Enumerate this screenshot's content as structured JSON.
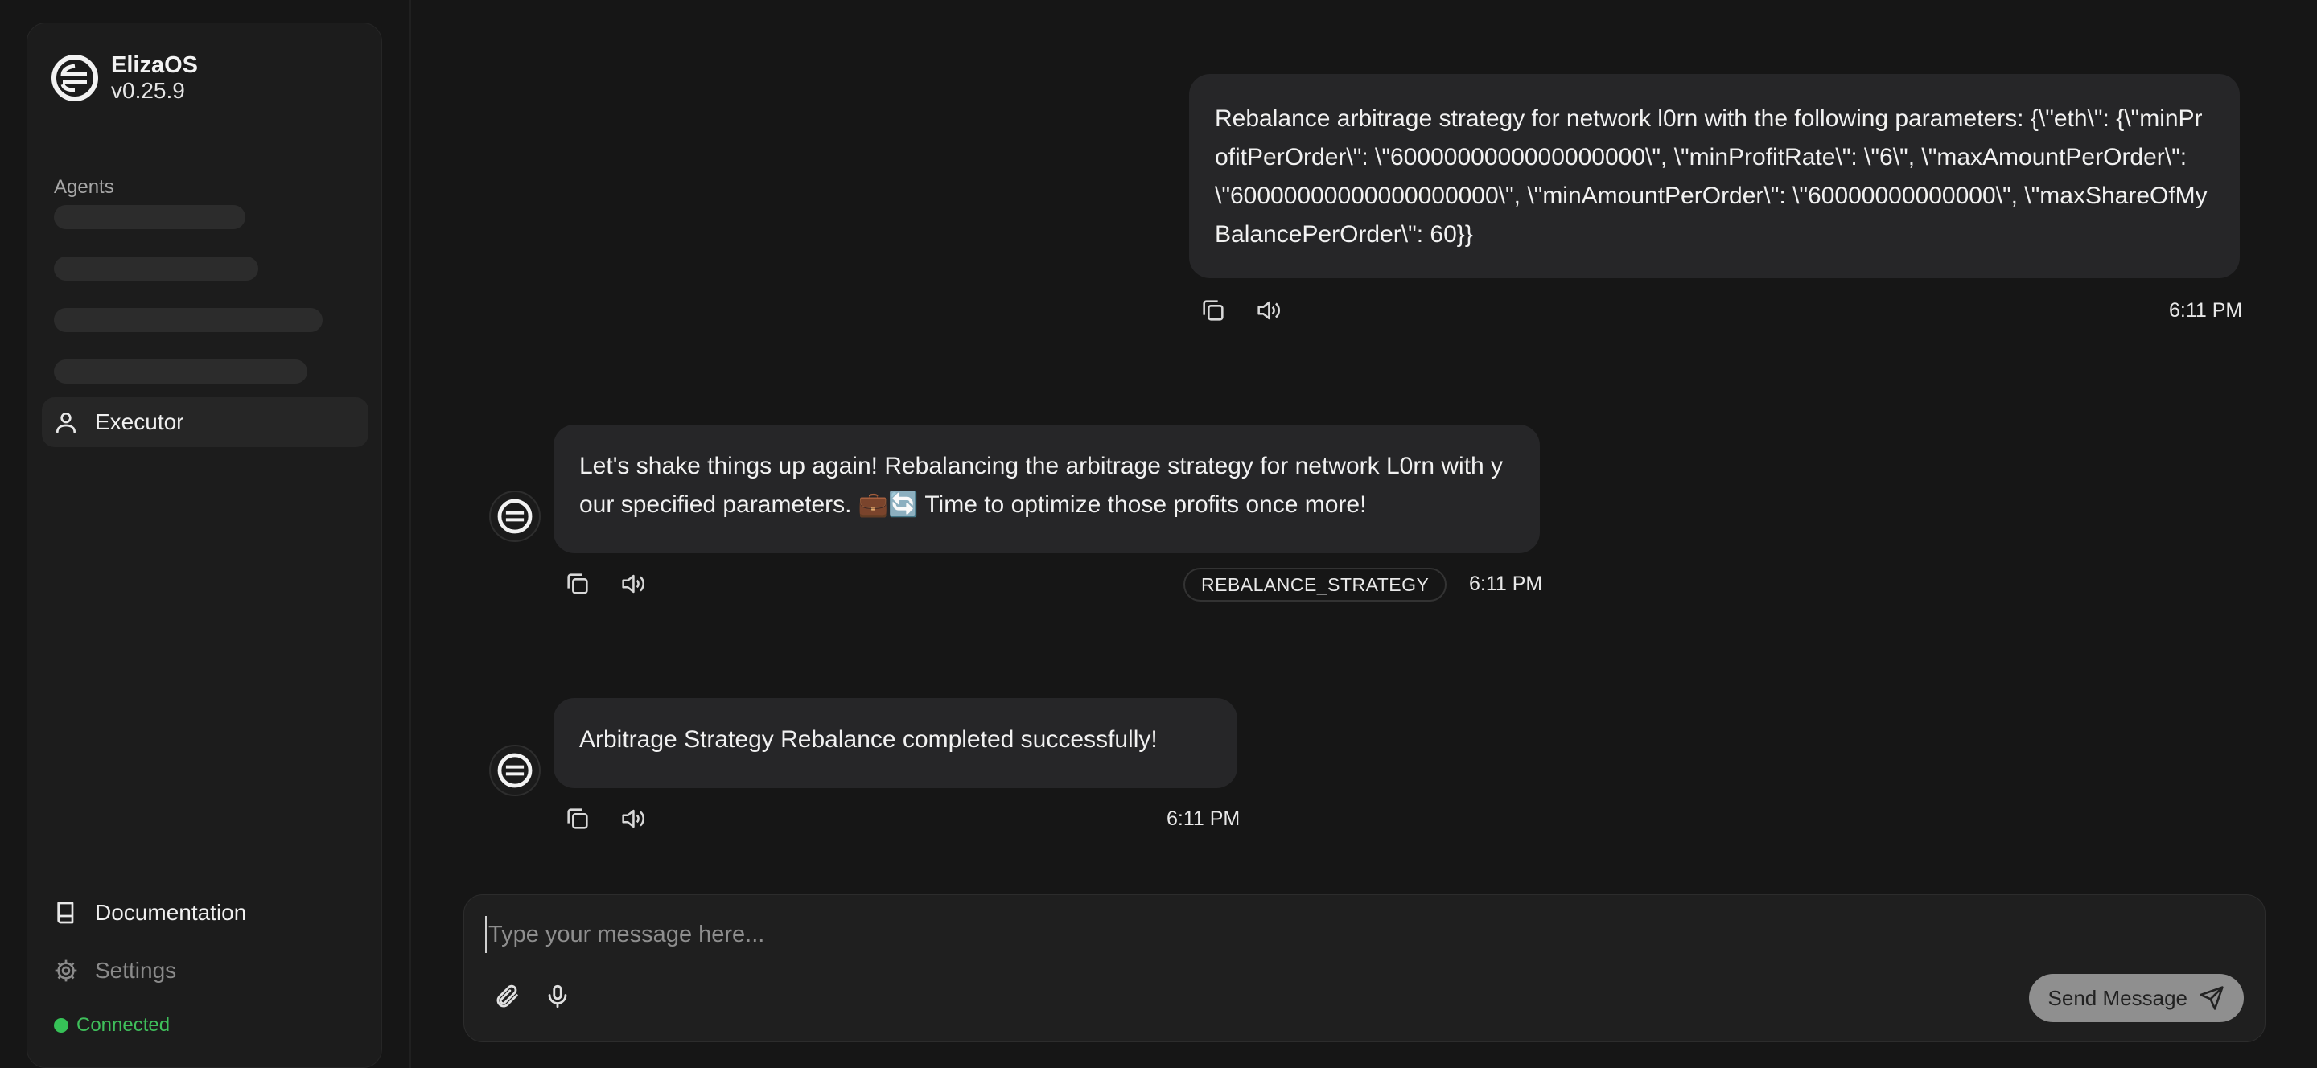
{
  "brand": {
    "name": "ElizaOS",
    "version": "v0.25.9",
    "logo_icon": "eliza-logo-icon"
  },
  "sidebar": {
    "section_label": "Agents",
    "active_agent": "Executor",
    "footer_links": [
      {
        "label": "Documentation",
        "icon": "book-icon"
      },
      {
        "label": "Settings",
        "icon": "gear-icon"
      }
    ],
    "status": "Connected"
  },
  "messages": [
    {
      "role": "user",
      "text": "Rebalance arbitrage strategy for network l0rn with the following parameters: {\\\"eth\\\": {\\\"minProfitPerOrder\\\": \\\"6000000000000000000\\\", \\\"minProfitRate\\\": \\\"6\\\", \\\"maxAmountPerOrder\\\": \\\"60000000000000000000\\\", \\\"minAmountPerOrder\\\": \\\"60000000000000\\\", \\\"maxShareOfMyBalancePerOrder\\\": 60}}",
      "time": "6:11 PM"
    },
    {
      "role": "agent",
      "text": "Let's shake things up again! Rebalancing the arbitrage strategy for network L0rn with your specified parameters. 💼🔄 Time to optimize those profits once more!",
      "action": "REBALANCE_STRATEGY",
      "time": "6:11 PM"
    },
    {
      "role": "agent",
      "text": "Arbitrage Strategy Rebalance completed successfully!",
      "time": "6:11 PM"
    }
  ],
  "composer": {
    "placeholder": "Type your message here...",
    "send_label": "Send Message"
  },
  "colors": {
    "background": "#161616",
    "bubble": "#262628",
    "status_green": "#36c157",
    "send_button": "#8f8f8f"
  }
}
